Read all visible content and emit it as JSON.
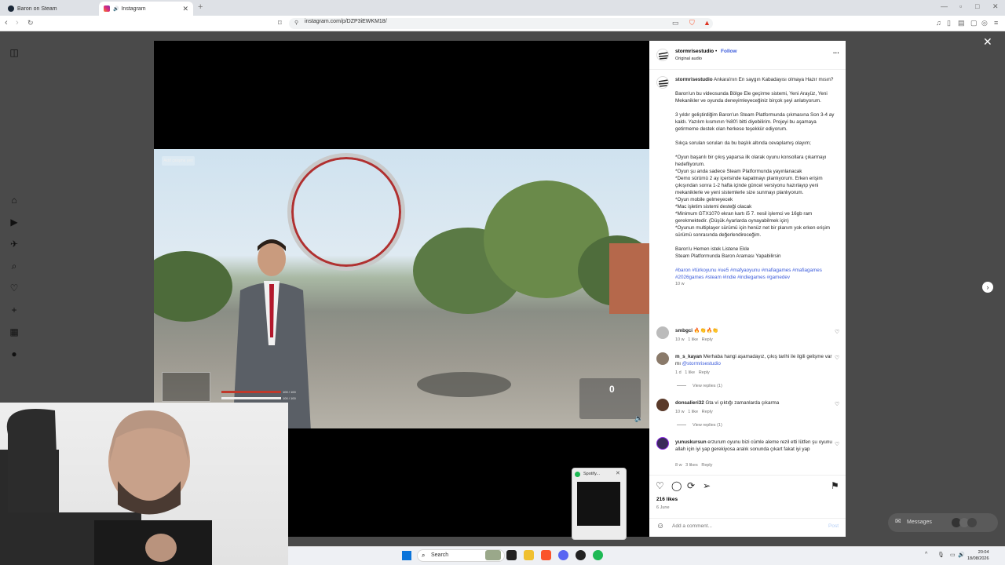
{
  "browser": {
    "tabs": [
      {
        "title": "Baron on Steam",
        "active": false
      },
      {
        "title": "Instagram",
        "active": true
      }
    ],
    "url": "instagram.com/p/DZP3iEWKM18/"
  },
  "video": {
    "badge": "Aktif çalışma yeri",
    "hp_text_1": "100 / 100",
    "hp_text_2": "100 / 100",
    "hud_number": "0"
  },
  "post": {
    "author": "stormrisestudio",
    "follow_label": "Follow",
    "separator": "•",
    "audio": "Original audio",
    "more_label": "···",
    "caption_author": "stormrisestudio",
    "caption_intro": "Ankara'nın En saygın Kabadayısı olmaya Hazır mısın?",
    "caption_paragraphs": [
      "Baron'un bu videosunda Bölge Ele geçirme sistemi, Yeni Arayüz, Yeni Mekanikler ve oyunda deneyimleyeceğiniz birçok şeyi anlatıyorum.",
      "3 yıldır geliştirdiğim Baron'un Steam Platformunda çıkmasına Son 3-4 ay kaldı. Yazılım kısmının %80'i bitti diyebilirim. Projeyi bu aşamaya getirmeme destek olan herkese teşekkür ediyorum.",
      "Sıkça sorulan soruları da bu başlık altında cevaplamış olayım;",
      "*Oyun başarılı bir çıkış yaparsa ilk olarak oyunu konsollara çıkarmayı hedefliyorum.\n*Oyun şu anda sadece Steam Platformunda yayınlanacak\n*Demo sürümü 2 ay içerisinde kapatmayı planlıyorum. Erken erişim çıkışından sonra 1-2 hafta içinde güncel versiyonu hazırlayıp yeni mekaniklerle ve yeni sistemlerle size sunmayı planlıyorum.\n*Oyun mobile gelmeyecek\n*Mac işletim sistemi desteği olacak\n*Minimum GTX1070 ekran kartı i5 7. nesil işlemci ve 16gb ram gerekmektedir. (Düşük Ayarlarda oynayabilmek için)\n*Oyunun multiplayer sürümü için henüz net bir planım yok erken erişim sürümü sonrasında değerlendireceğim.",
      "Baron'u Hemen istek Listene Ekle\nSteam Platformunda Baron Araması Yapabilirsin"
    ],
    "hashtags": "#baron #türkoyunu #ue5 #mafyaoyunu #mafiagames #mafiagames #2026games #steam #indie #indiegames #gamedev",
    "caption_time": "10 w",
    "comments": [
      {
        "user": "smbgci",
        "text": "🔥👏🔥👏",
        "time": "10 w",
        "likes": "1 like",
        "reply": "Reply"
      },
      {
        "user": "m_s_kayan",
        "text": "Merhaba hangi aşamadayız, çıkış tarihi ile ilgili gelişme var mı",
        "mention": "@stormrisestudio",
        "time": "1 d",
        "likes": "1 like",
        "reply": "Reply",
        "view_replies": "View replies (1)"
      },
      {
        "user": "donsalieri32",
        "text": "Gta vi çıktığı zamanlarda çıkarma",
        "time": "10 w",
        "likes": "1 like",
        "reply": "Reply",
        "view_replies": "View replies (1)"
      },
      {
        "user": "yunuskursun",
        "text": "erzurum oyunu bizi cümle aleme rezil etti lütfen şu oyunu allah için iyi yap gerekiyosa aralık sonunda çıkart fakat iyi yap",
        "time": "8 w",
        "likes": "3 likes",
        "reply": "Reply"
      }
    ],
    "like_count": "216 likes",
    "date": "6 June",
    "add_comment_placeholder": "Add a comment...",
    "post_label": "Post"
  },
  "messages_label": "Messages",
  "spotify_label": "Spotify...",
  "taskbar": {
    "search": "Search",
    "time": "20:04",
    "date": "18/08/2026"
  },
  "colors": {
    "accent": "#3b5bdb",
    "backdrop": "#4a4a4a",
    "spotify": "#1db954"
  }
}
